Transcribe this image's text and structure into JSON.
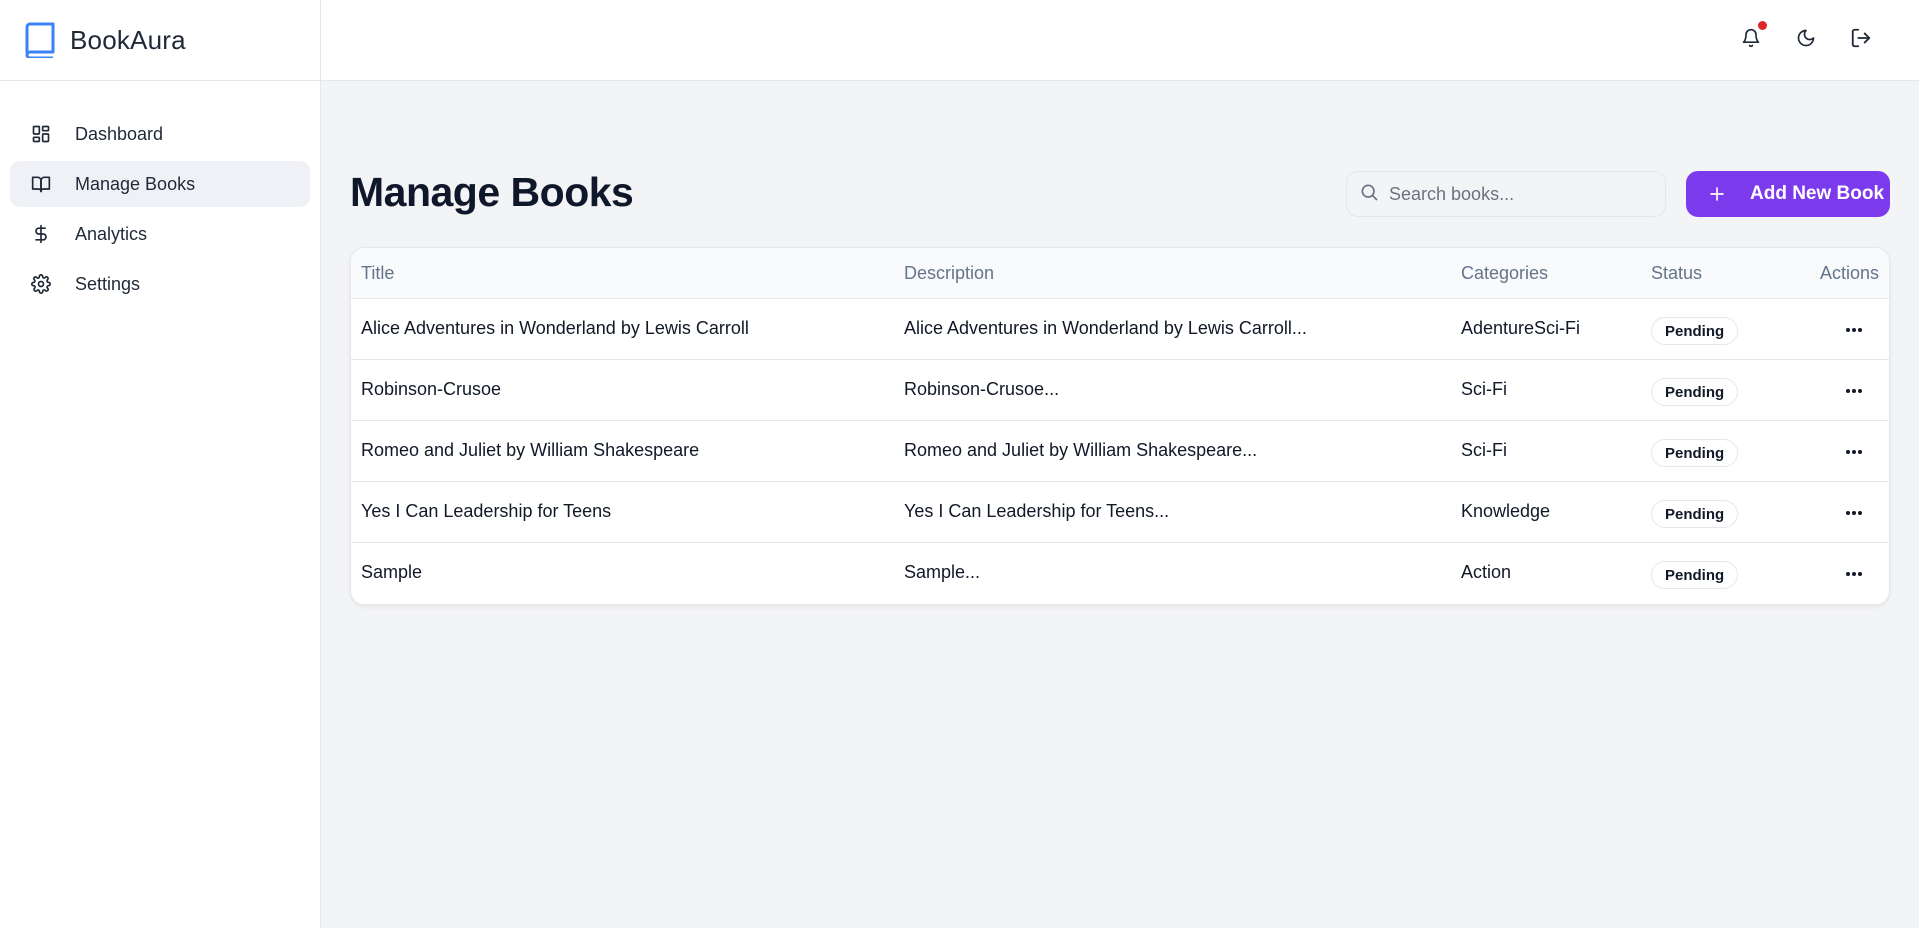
{
  "brand": {
    "name": "BookAura",
    "icon": "book-icon"
  },
  "sidebar": {
    "items": [
      {
        "label": "Dashboard",
        "icon": "dashboard-icon",
        "active": false
      },
      {
        "label": "Manage Books",
        "icon": "open-book-icon",
        "active": true
      },
      {
        "label": "Analytics",
        "icon": "dollar-icon",
        "active": false
      },
      {
        "label": "Settings",
        "icon": "gear-icon",
        "active": false
      }
    ]
  },
  "header": {
    "icons": [
      "bell-icon",
      "moon-icon",
      "logout-icon"
    ],
    "has_notification": true
  },
  "main": {
    "title": "Manage Books",
    "search": {
      "placeholder": "Search books...",
      "value": ""
    },
    "add_button": {
      "label": "Add New Book"
    }
  },
  "table": {
    "columns": [
      "Title",
      "Description",
      "Categories",
      "Status",
      "Actions"
    ],
    "rows": [
      {
        "title": "Alice Adventures in Wonderland by Lewis Carroll",
        "description": "Alice Adventures in Wonderland by Lewis Carroll...",
        "categories": "AdentureSci-Fi",
        "status": "Pending"
      },
      {
        "title": "Robinson-Crusoe",
        "description": "Robinson-Crusoe...",
        "categories": "Sci-Fi",
        "status": "Pending"
      },
      {
        "title": "Romeo and Juliet by William Shakespeare",
        "description": "Romeo and Juliet by William Shakespeare...",
        "categories": "Sci-Fi",
        "status": "Pending"
      },
      {
        "title": "Yes I Can Leadership for Teens",
        "description": "Yes I Can Leadership for Teens...",
        "categories": "Knowledge",
        "status": "Pending"
      },
      {
        "title": "Sample",
        "description": "Sample...",
        "categories": "Action",
        "status": "Pending"
      }
    ]
  },
  "colors": {
    "accent": "#7c3aed",
    "brand_blue": "#3b82f6",
    "notification": "#dc2626",
    "background": "#f3f4f6"
  }
}
